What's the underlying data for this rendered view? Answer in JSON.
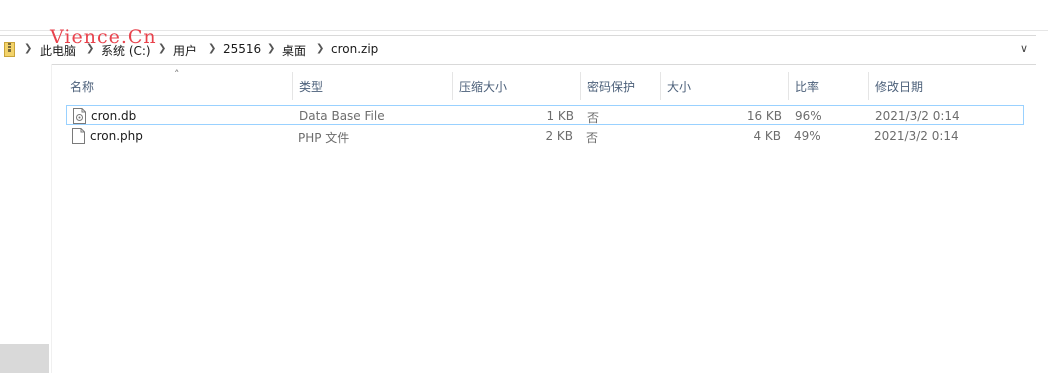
{
  "watermark": "Vience.Cn",
  "breadcrumb": [
    "此电脑",
    "系统 (C:)",
    "用户",
    "25516",
    "桌面",
    "cron.zip"
  ],
  "columns": {
    "name": "名称",
    "type": "类型",
    "compressed_size": "压缩大小",
    "password": "密码保护",
    "size": "大小",
    "ratio": "比率",
    "modified": "修改日期"
  },
  "files": [
    {
      "name": "cron.db",
      "type": "Data Base File",
      "compressed_size": "1 KB",
      "password": "否",
      "size": "16 KB",
      "ratio": "96%",
      "modified": "2021/3/2 0:14",
      "icon": "database-file-icon"
    },
    {
      "name": "cron.php",
      "type": "PHP 文件",
      "compressed_size": "2 KB",
      "password": "否",
      "size": "4 KB",
      "ratio": "49%",
      "modified": "2021/3/2 0:14",
      "icon": "document-file-icon"
    }
  ],
  "colors": {
    "header_text": "#4c607a",
    "selection_border": "#99d1ff",
    "watermark": "#e8424c"
  }
}
